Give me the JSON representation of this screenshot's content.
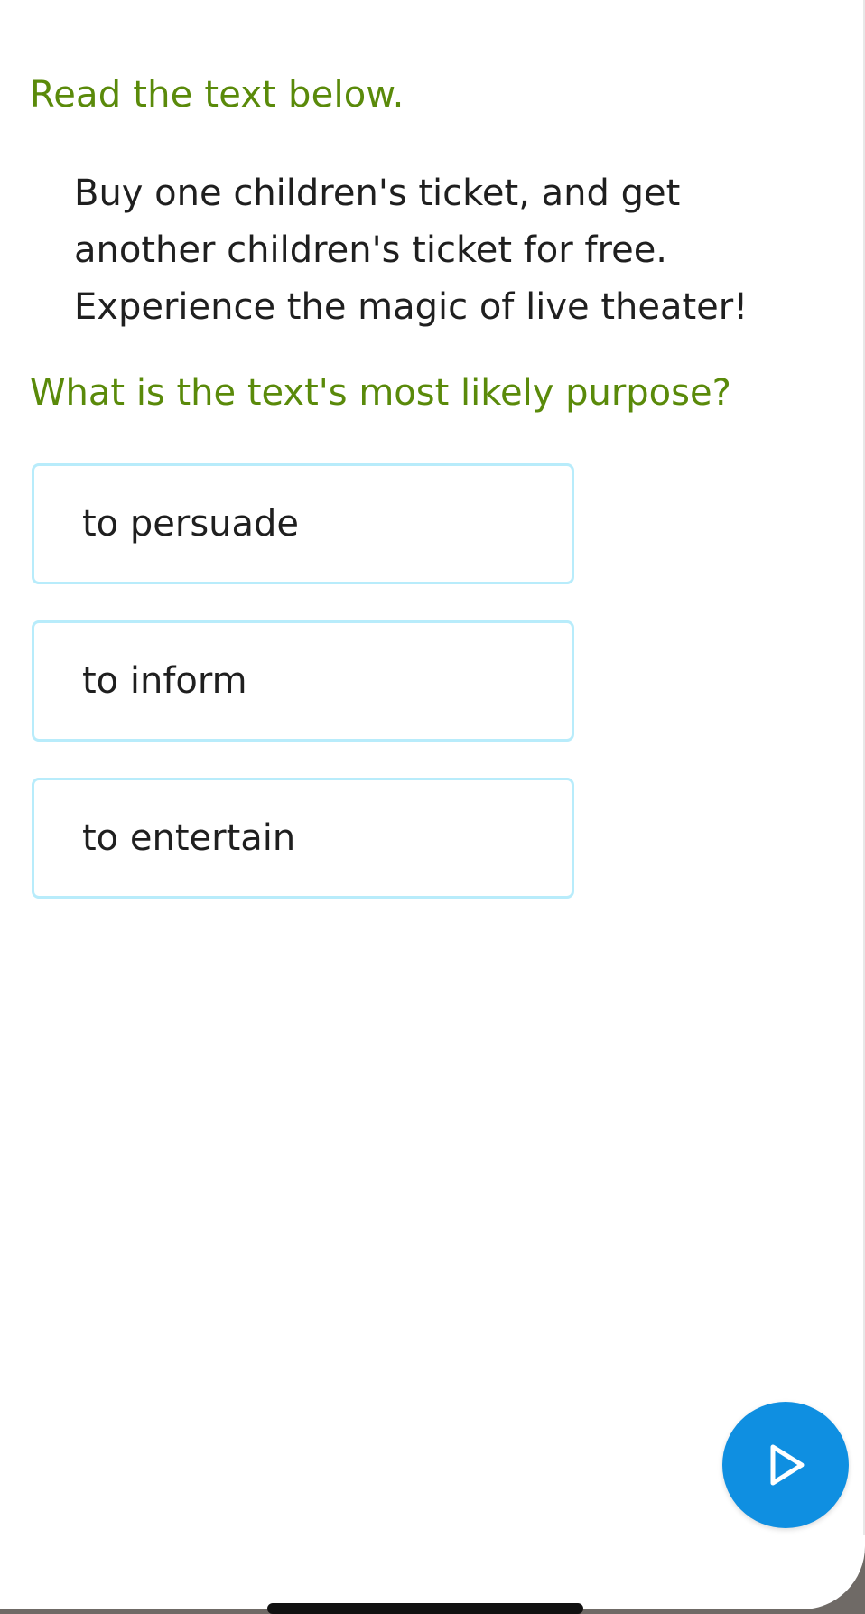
{
  "instruction": "Read the text below.",
  "passage": {
    "lines": [
      "Buy one children's ticket, and get",
      "another children's ticket for free.",
      "Experience the magic of live theater!"
    ]
  },
  "question": "What is the text's most likely purpose?",
  "choices": [
    {
      "label": "to persuade"
    },
    {
      "label": "to inform"
    },
    {
      "label": "to entertain"
    }
  ],
  "play_button": {
    "icon": "play-icon",
    "color": "#0f8fe1"
  },
  "colors": {
    "prompt_green": "#5a8a0a",
    "choice_border": "#b8ecfb",
    "text": "#1f1f1f"
  }
}
